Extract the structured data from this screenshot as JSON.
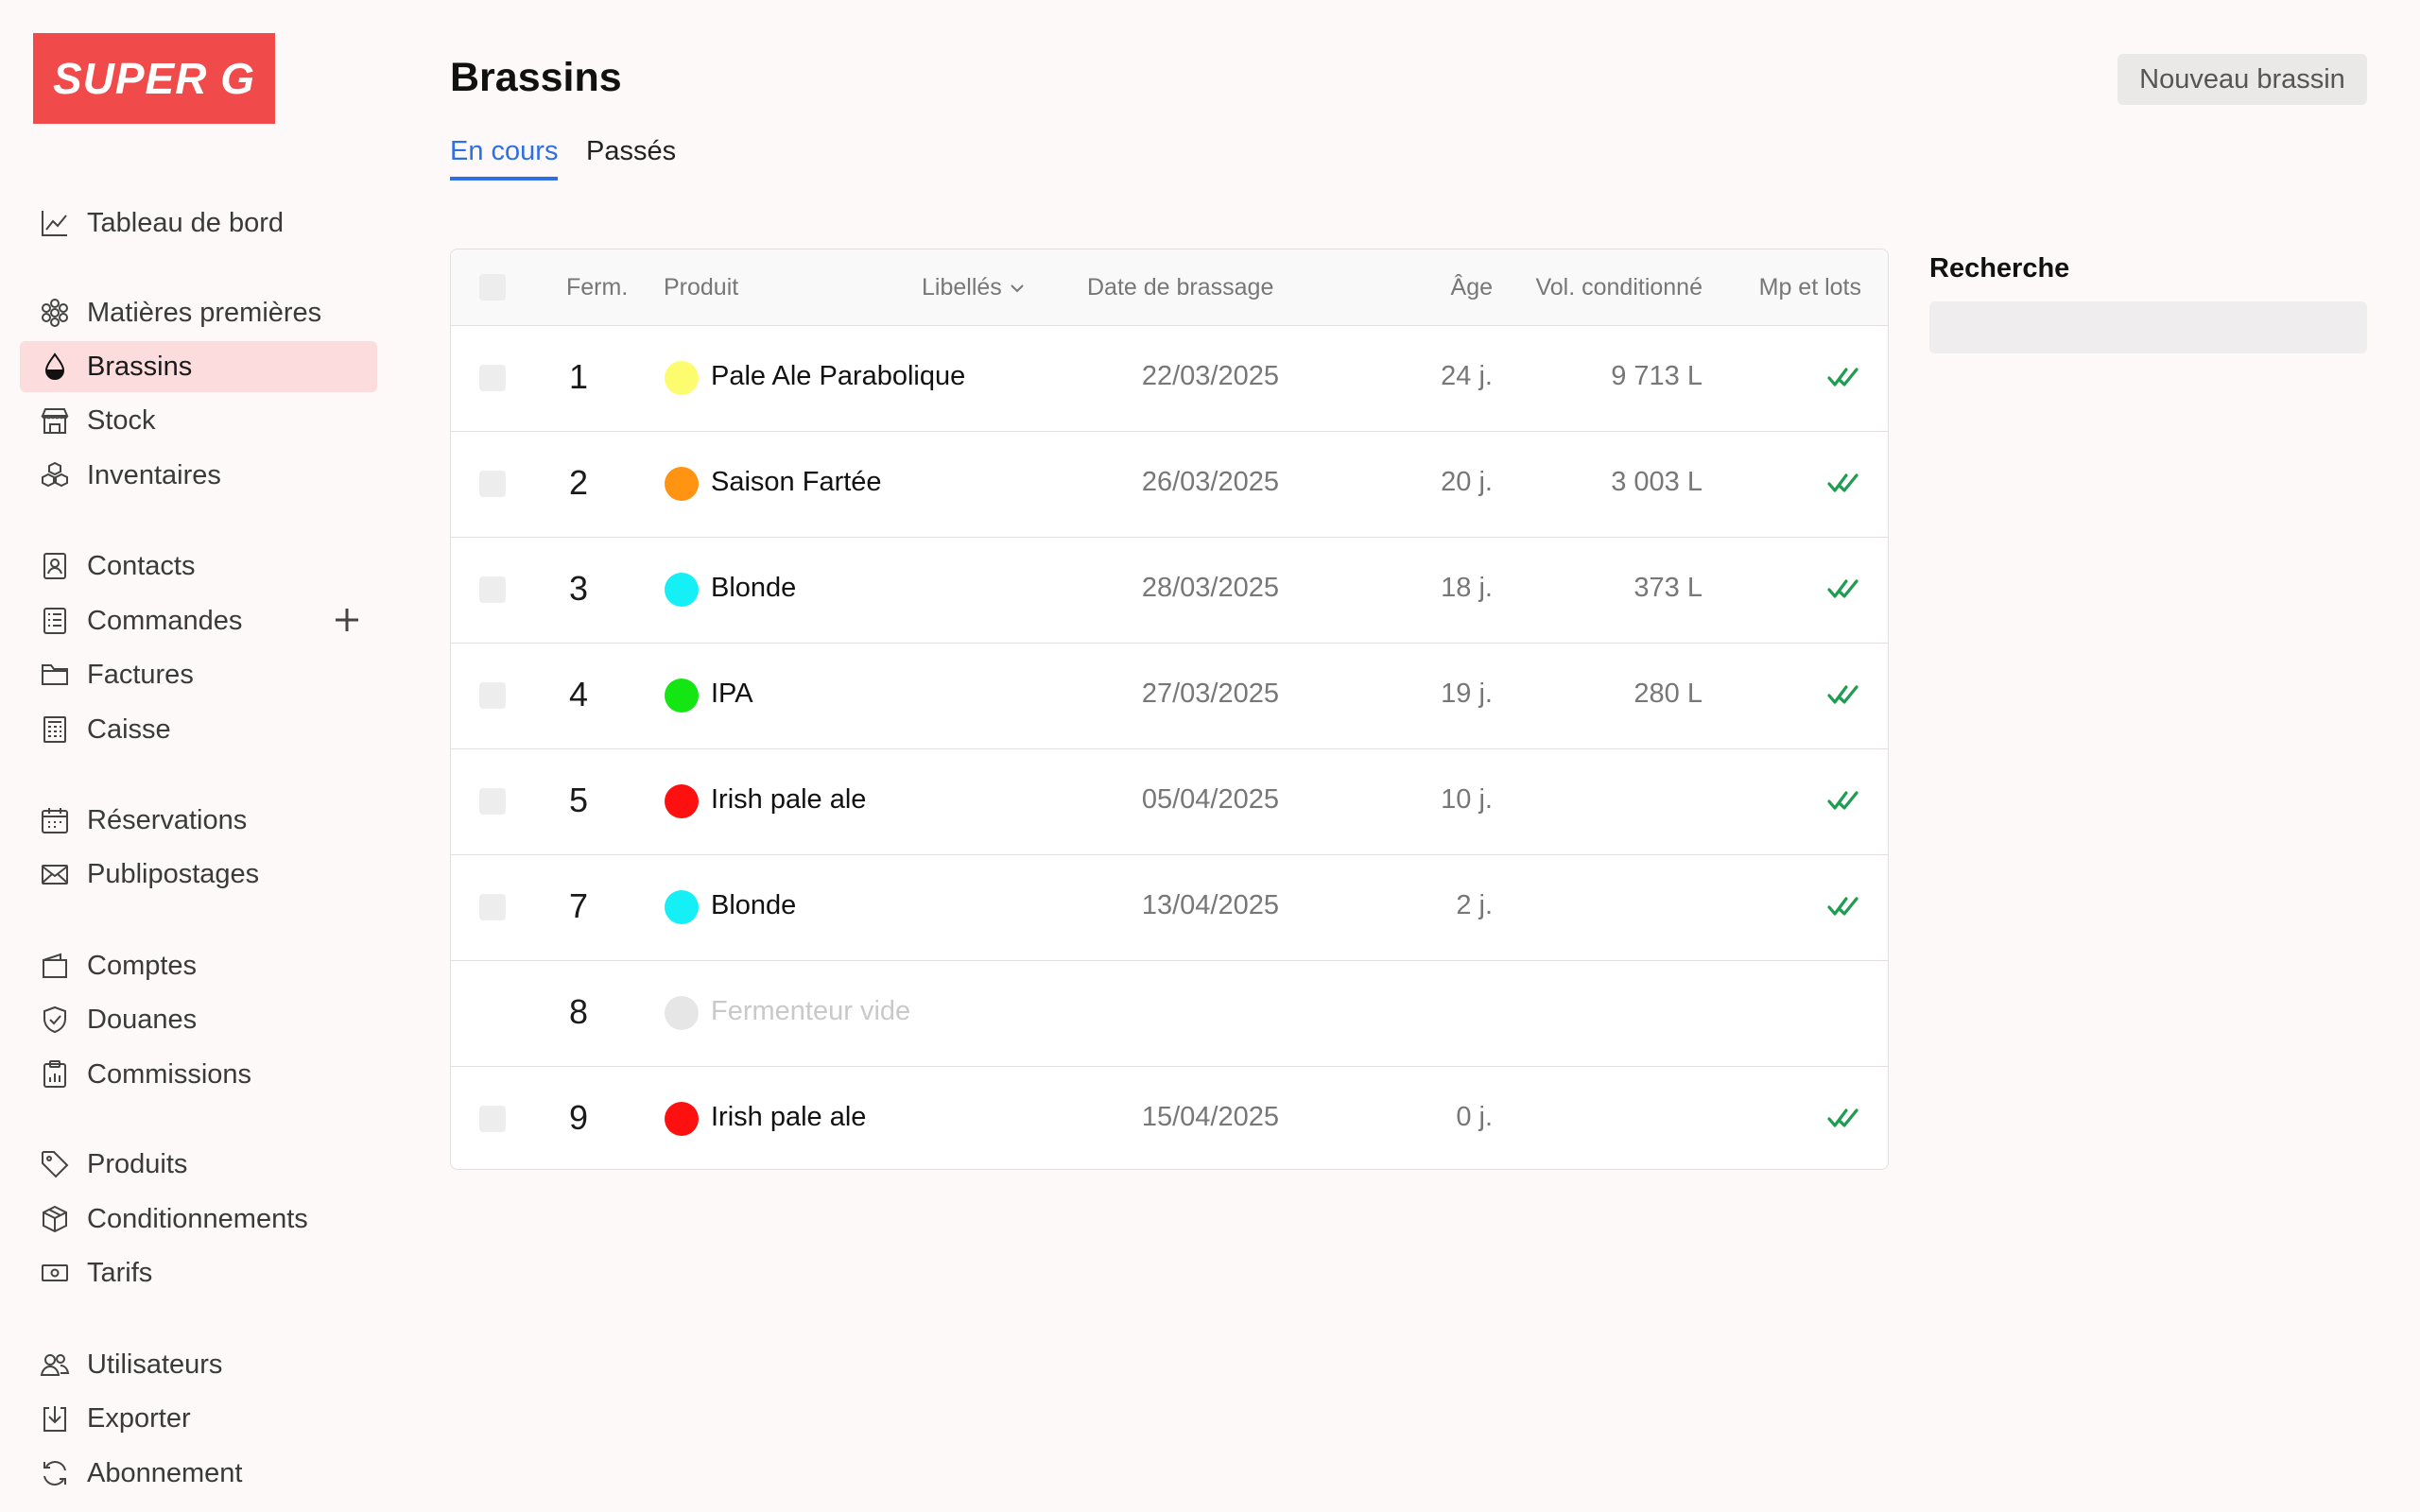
{
  "brand": {
    "logo_text": "SUPER G",
    "accent_color": "#f04a4a"
  },
  "sidebar": {
    "items": [
      {
        "label": "Tableau de bord",
        "icon": "chart-line-icon"
      },
      {
        "label": "Matières premières",
        "icon": "hop-icon"
      },
      {
        "label": "Brassins",
        "icon": "drop-icon",
        "active": true
      },
      {
        "label": "Stock",
        "icon": "store-icon"
      },
      {
        "label": "Inventaires",
        "icon": "boxes-icon"
      },
      {
        "label": "Contacts",
        "icon": "contact-card-icon"
      },
      {
        "label": "Commandes",
        "icon": "order-list-icon",
        "has_add": true
      },
      {
        "label": "Factures",
        "icon": "folder-icon"
      },
      {
        "label": "Caisse",
        "icon": "register-icon"
      },
      {
        "label": "Réservations",
        "icon": "calendar-icon"
      },
      {
        "label": "Publipostages",
        "icon": "envelope-icon"
      },
      {
        "label": "Comptes",
        "icon": "wallet-icon"
      },
      {
        "label": "Douanes",
        "icon": "shield-icon"
      },
      {
        "label": "Commissions",
        "icon": "clipboard-chart-icon"
      },
      {
        "label": "Produits",
        "icon": "tag-icon"
      },
      {
        "label": "Conditionnements",
        "icon": "package-icon"
      },
      {
        "label": "Tarifs",
        "icon": "banknote-icon"
      },
      {
        "label": "Utilisateurs",
        "icon": "users-icon"
      },
      {
        "label": "Exporter",
        "icon": "download-icon"
      },
      {
        "label": "Abonnement",
        "icon": "refresh-icon"
      }
    ]
  },
  "header": {
    "title": "Brassins",
    "new_button_label": "Nouveau brassin",
    "tabs": [
      {
        "label": "En cours",
        "active": true
      },
      {
        "label": "Passés",
        "active": false
      }
    ]
  },
  "table": {
    "columns": {
      "ferm": "Ferm.",
      "produit": "Produit",
      "libelles": "Libellés",
      "date": "Date de brassage",
      "age": "Âge",
      "vol": "Vol. conditionné",
      "mp": "Mp et lots"
    },
    "rows": [
      {
        "ferm": "1",
        "produit": "Pale Ale Parabolique",
        "color": "#fcfc6e",
        "date": "22/03/2025",
        "age": "24 j.",
        "vol": "9 713 L",
        "mp_ok": true,
        "selectable": true
      },
      {
        "ferm": "2",
        "produit": "Saison Fartée",
        "color": "#ff9412",
        "date": "26/03/2025",
        "age": "20 j.",
        "vol": "3 003 L",
        "mp_ok": true,
        "selectable": true
      },
      {
        "ferm": "3",
        "produit": "Blonde",
        "color": "#14f0f5",
        "date": "28/03/2025",
        "age": "18 j.",
        "vol": "373 L",
        "mp_ok": true,
        "selectable": true
      },
      {
        "ferm": "4",
        "produit": "IPA",
        "color": "#14e614",
        "date": "27/03/2025",
        "age": "19 j.",
        "vol": "280 L",
        "mp_ok": true,
        "selectable": true
      },
      {
        "ferm": "5",
        "produit": "Irish pale ale",
        "color": "#ff1010",
        "date": "05/04/2025",
        "age": "10 j.",
        "vol": "",
        "mp_ok": true,
        "selectable": true
      },
      {
        "ferm": "7",
        "produit": "Blonde",
        "color": "#14f0f5",
        "date": "13/04/2025",
        "age": "2 j.",
        "vol": "",
        "mp_ok": true,
        "selectable": true
      },
      {
        "ferm": "8",
        "produit": "Fermenteur vide",
        "color": "#e6e6e6",
        "date": "",
        "age": "",
        "vol": "",
        "mp_ok": false,
        "selectable": false,
        "empty": true
      },
      {
        "ferm": "9",
        "produit": "Irish pale ale",
        "color": "#ff1010",
        "date": "15/04/2025",
        "age": "0 j.",
        "vol": "",
        "mp_ok": true,
        "selectable": true
      }
    ]
  },
  "search": {
    "label": "Recherche",
    "placeholder": ""
  }
}
